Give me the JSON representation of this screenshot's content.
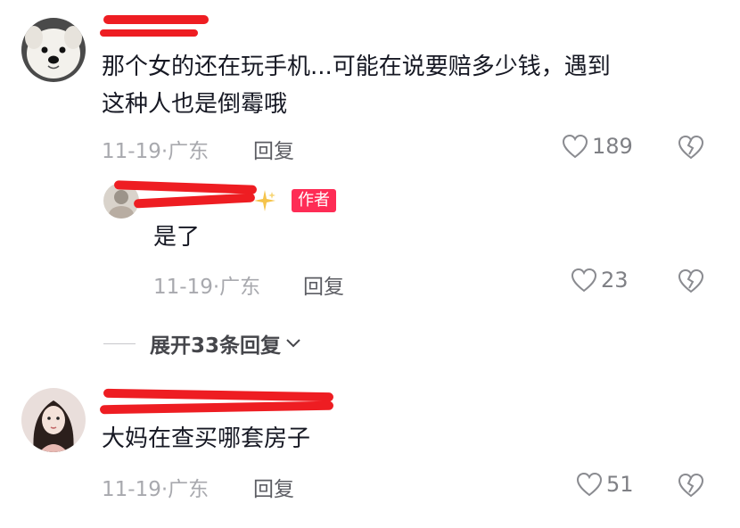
{
  "comments": [
    {
      "text_line1": "那个女的还在玩手机...可能在说要赔多少钱，遇到",
      "text_line2": "这种人也是倒霉哦",
      "date": "11-19·广东",
      "reply_label": "回复",
      "likes": "189"
    },
    {
      "text": "大妈在查买哪套房子",
      "date": "11-19·广东",
      "reply_label": "回复",
      "likes": "51"
    }
  ],
  "reply": {
    "badge": "作者",
    "text": "是了",
    "date": "11-19·广东",
    "reply_label": "回复",
    "likes": "23"
  },
  "expand_label": "展开33条回复",
  "colors": {
    "redaction": "#ee1d22",
    "author_badge": "#fe2c55",
    "meta_gray": "#a8a9ae"
  },
  "icons": {
    "like": "heart-outline-icon",
    "dislike": "broken-heart-icon",
    "expand": "chevron-down-icon",
    "sparkle": "sparkle-icon"
  }
}
